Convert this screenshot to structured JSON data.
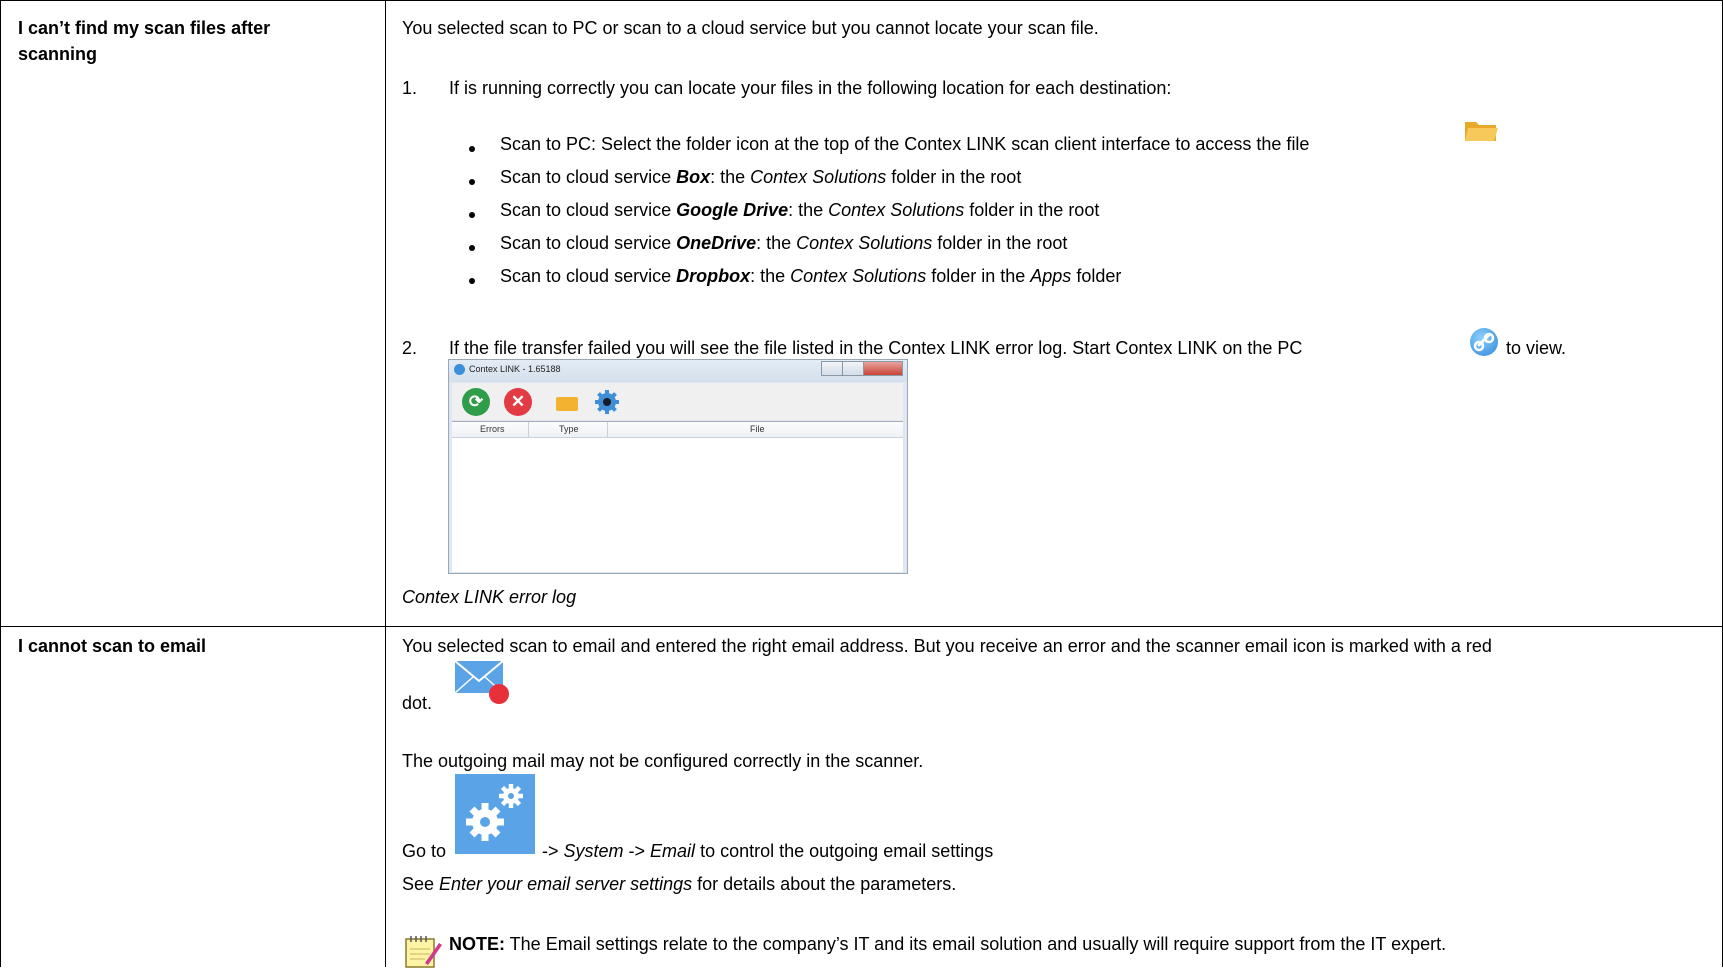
{
  "rows": [
    {
      "title_line1": "I can’t find my scan files after",
      "title_line2": "scanning",
      "intro": "You selected scan to PC or scan to a cloud service but you cannot locate your scan file.",
      "step1_number": "1.",
      "step1_text": "If is running correctly you can  locate your files in the following location for each destination:",
      "bullets": [
        {
          "prefix": "Scan to PC: Select the folder icon at the top of the Contex LINK scan client interface to access the file",
          "icon": "folder-icon"
        },
        {
          "prefix": "Scan to cloud service ",
          "service": "Box",
          "mid": ": the ",
          "folder": "Contex Solutions",
          "suffix": " folder  in the root"
        },
        {
          "prefix": "Scan to cloud service ",
          "service": "Google Drive",
          "mid": ": the ",
          "folder": "Contex Solutions",
          "suffix": " folder  in the root"
        },
        {
          "prefix": "Scan to cloud service ",
          "service": "OneDrive",
          "mid": ": the ",
          "folder": "Contex Solutions",
          "suffix": " folder  in the root"
        },
        {
          "prefix": "Scan to cloud service ",
          "service": "Dropbox",
          "mid": ": the ",
          "folder": "Contex Solutions",
          "suffix": " folder  in the ",
          "folder2": "Apps",
          "suffix2": " folder"
        }
      ],
      "step2_number": "2.",
      "step2_text": "If the file transfer failed you will see the file listed in the Contex LINK error log.  Start Contex LINK on the PC",
      "step2_suffix": "to view.",
      "window": {
        "title": "Contex LINK - 1.65188",
        "columns": [
          "Errors",
          "Type",
          "File"
        ]
      },
      "caption": "Contex LINK error log"
    },
    {
      "title_line1": "I cannot scan to email",
      "intro_line1": "You selected scan to email and entered the right email address. But you receive an error and the scanner email icon is marked with a red",
      "intro_line2": "dot.",
      "para2": "The outgoing mail may not be configured correctly in the scanner.",
      "goto_prefix": "Go to",
      "goto_path1": "System",
      "goto_path2": "Email",
      "goto_suffix": " to control the outgoing email settings",
      "see_prefix": "See ",
      "see_italic": "Enter your email server settings",
      "see_suffix": " for details about the parameters.",
      "note_label": "NOTE:",
      "note_text": " The Email settings relate to the company’s IT and its email solution and usually will require support from the IT expert."
    }
  ]
}
